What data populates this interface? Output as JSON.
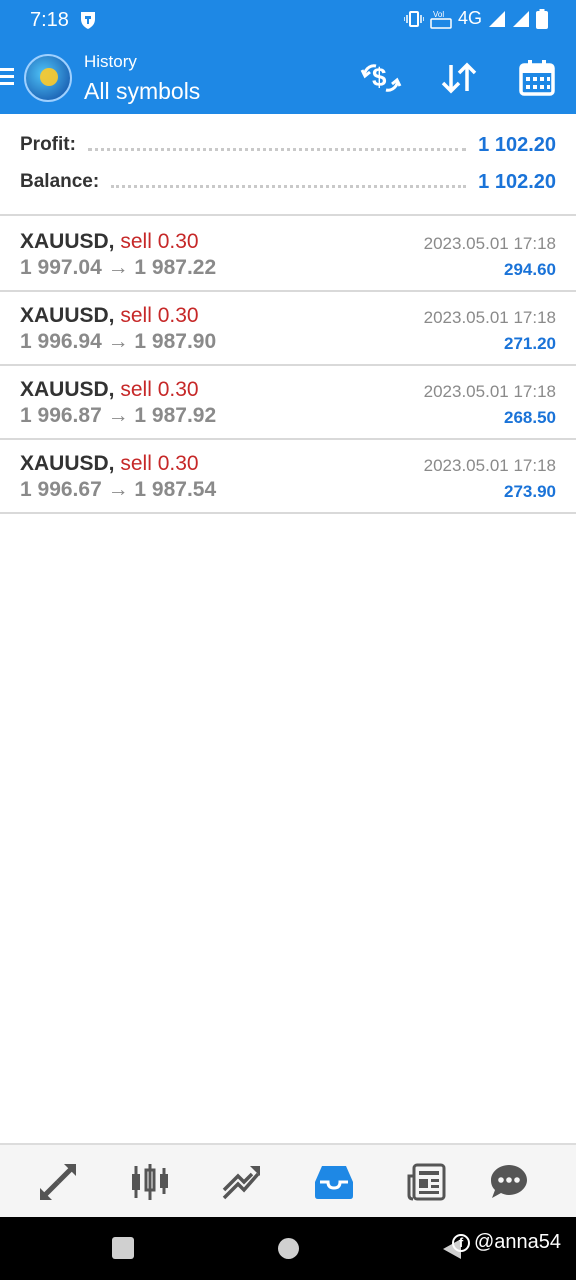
{
  "status_bar": {
    "time": "7:18",
    "network": "4G"
  },
  "app_bar": {
    "subtitle": "History",
    "title": "All symbols"
  },
  "summary": {
    "profit_label": "Profit:",
    "profit_value": "1 102.20",
    "balance_label": "Balance:",
    "balance_value": "1 102.20"
  },
  "deals": [
    {
      "symbol": "XAUUSD,",
      "type": "sell 0.30",
      "prices": "1 997.04 → 1 987.22",
      "time": "2023.05.01 17:18",
      "profit": "294.60"
    },
    {
      "symbol": "XAUUSD,",
      "type": "sell 0.30",
      "prices": "1 996.94 → 1 987.90",
      "time": "2023.05.01 17:18",
      "profit": "271.20"
    },
    {
      "symbol": "XAUUSD,",
      "type": "sell 0.30",
      "prices": "1 996.87 → 1 987.92",
      "time": "2023.05.01 17:18",
      "profit": "268.50"
    },
    {
      "symbol": "XAUUSD,",
      "type": "sell 0.30",
      "prices": "1 996.67 → 1 987.54",
      "time": "2023.05.01 17:18",
      "profit": "273.90"
    }
  ],
  "bottom_nav": {
    "items": [
      "quotes-icon",
      "chart-icon",
      "trade-icon",
      "history-icon",
      "news-icon",
      "chat-icon"
    ],
    "active": "history-icon"
  },
  "watermark": {
    "handle": "@anna54"
  },
  "colors": {
    "primary": "#1e88e5",
    "profit": "#1a73d8",
    "sell": "#c62828",
    "muted": "#8a8a8a"
  }
}
